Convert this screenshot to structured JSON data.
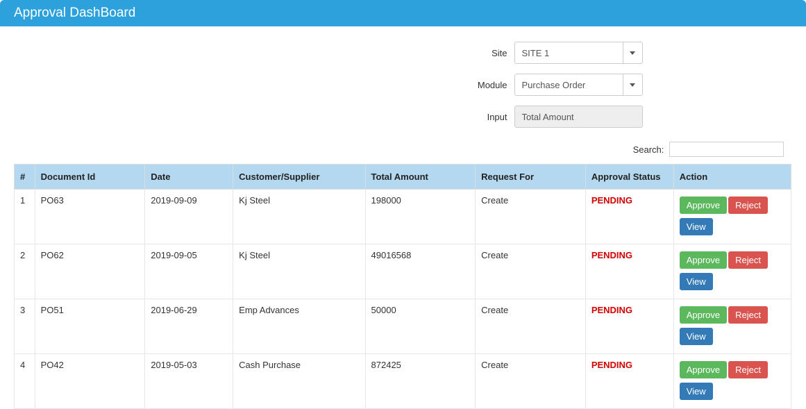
{
  "header": {
    "title": "Approval DashBoard"
  },
  "filters": {
    "site_label": "Site",
    "site_value": "SITE 1",
    "module_label": "Module",
    "module_value": "Purchase Order",
    "input_label": "Input",
    "input_value": "Total Amount"
  },
  "search": {
    "label": "Search:",
    "value": ""
  },
  "table": {
    "headers": {
      "num": "#",
      "docid": "Document Id",
      "date": "Date",
      "cust": "Customer/Supplier",
      "amt": "Total Amount",
      "req": "Request For",
      "stat": "Approval Status",
      "act": "Action"
    },
    "buttons": {
      "approve": "Approve",
      "reject": "Reject",
      "view": "View"
    },
    "rows": [
      {
        "num": "1",
        "docid": "PO63",
        "date": "2019-09-09",
        "cust": "Kj Steel",
        "amt": "198000",
        "req": "Create",
        "stat": "PENDING"
      },
      {
        "num": "2",
        "docid": "PO62",
        "date": "2019-09-05",
        "cust": "Kj Steel",
        "amt": "49016568",
        "req": "Create",
        "stat": "PENDING"
      },
      {
        "num": "3",
        "docid": "PO51",
        "date": "2019-06-29",
        "cust": "Emp Advances",
        "amt": "50000",
        "req": "Create",
        "stat": "PENDING"
      },
      {
        "num": "4",
        "docid": "PO42",
        "date": "2019-05-03",
        "cust": "Cash Purchase",
        "amt": "872425",
        "req": "Create",
        "stat": "PENDING"
      }
    ]
  }
}
